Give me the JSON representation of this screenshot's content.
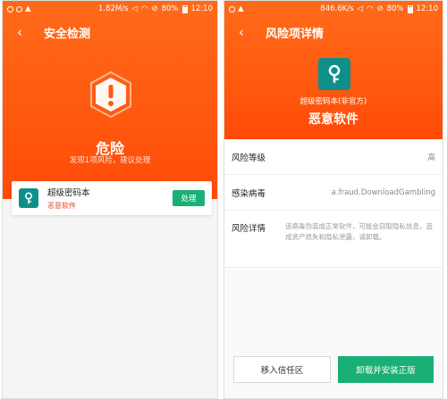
{
  "status_left": {
    "speed": "1.82M/s",
    "battery": "80%",
    "time": "12:10"
  },
  "status_right": {
    "speed": "846.6K/s",
    "battery": "80%",
    "time": "12:10"
  },
  "scan_screen": {
    "title": "安全检测",
    "status_icon": "warning-hexagon-icon",
    "status_title": "危险",
    "status_subtitle": "发现1项风险，建议处理",
    "risk_item": {
      "icon": "key-icon",
      "app_name": "超级密码本",
      "risk_tag": "恶意软件",
      "action_label": "处理"
    }
  },
  "detail_screen": {
    "title": "风险项详情",
    "app_icon": "key-icon",
    "app_name": "超级密码本(非官方)",
    "category": "恶意软件",
    "rows": [
      {
        "label": "风险等级",
        "value": "高"
      },
      {
        "label": "感染病毒",
        "value": "a.fraud.DownloadGambling"
      },
      {
        "label": "风险详情",
        "value": "该病毒伪装成正常软件，可能会窃取隐私信息，造成资产损失和隐私泄露，请卸载。"
      }
    ],
    "buttons": {
      "trust": "移入信任区",
      "uninstall": "卸载并安装正版"
    }
  },
  "colors": {
    "brand_orange": "#ff5a10",
    "action_green": "#1aaf74",
    "app_teal": "#0f8f8a",
    "risk_red": "#e9452d"
  }
}
